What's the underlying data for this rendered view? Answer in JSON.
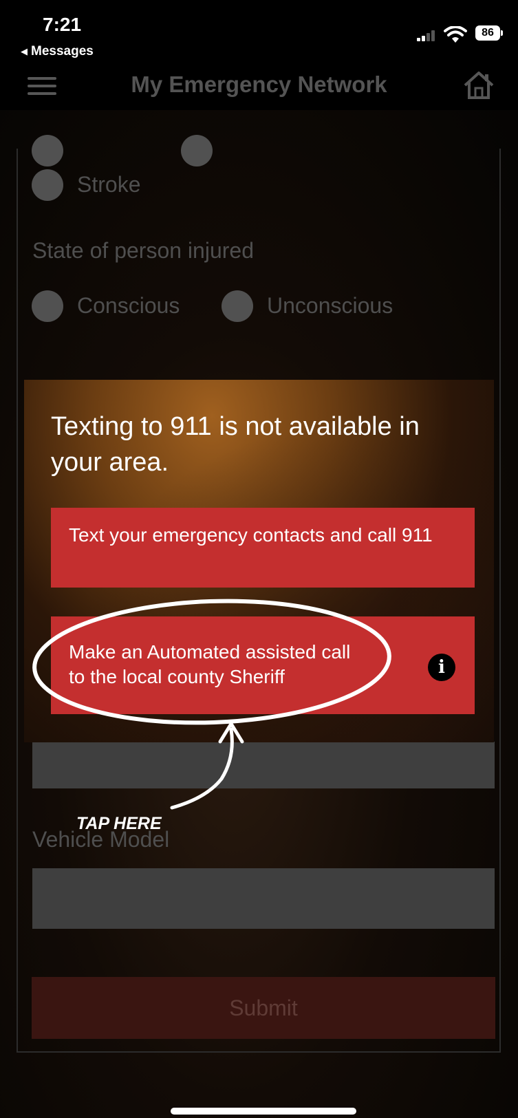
{
  "status_bar": {
    "time": "7:21",
    "back_label": "Messages",
    "battery": "86"
  },
  "header": {
    "title": "My Emergency Network",
    "menu_icon": "hamburger-menu-icon",
    "home_icon": "home-icon"
  },
  "form": {
    "condition_option": "Stroke",
    "state_heading": "State of person injured",
    "state_options": [
      "Conscious",
      "Unconscious"
    ],
    "vehicle_model_label": "Vehicle Model",
    "submit_label": "Submit"
  },
  "modal": {
    "title": "Texting to 911 is not available in your area.",
    "option_1": "Text your emergency contacts and call 911",
    "option_2": "Make an Automated assisted call to the local county Sheriff",
    "info_icon": "i",
    "accent_color": "#c42f2f"
  },
  "annotation": {
    "label": "TAP HERE"
  }
}
